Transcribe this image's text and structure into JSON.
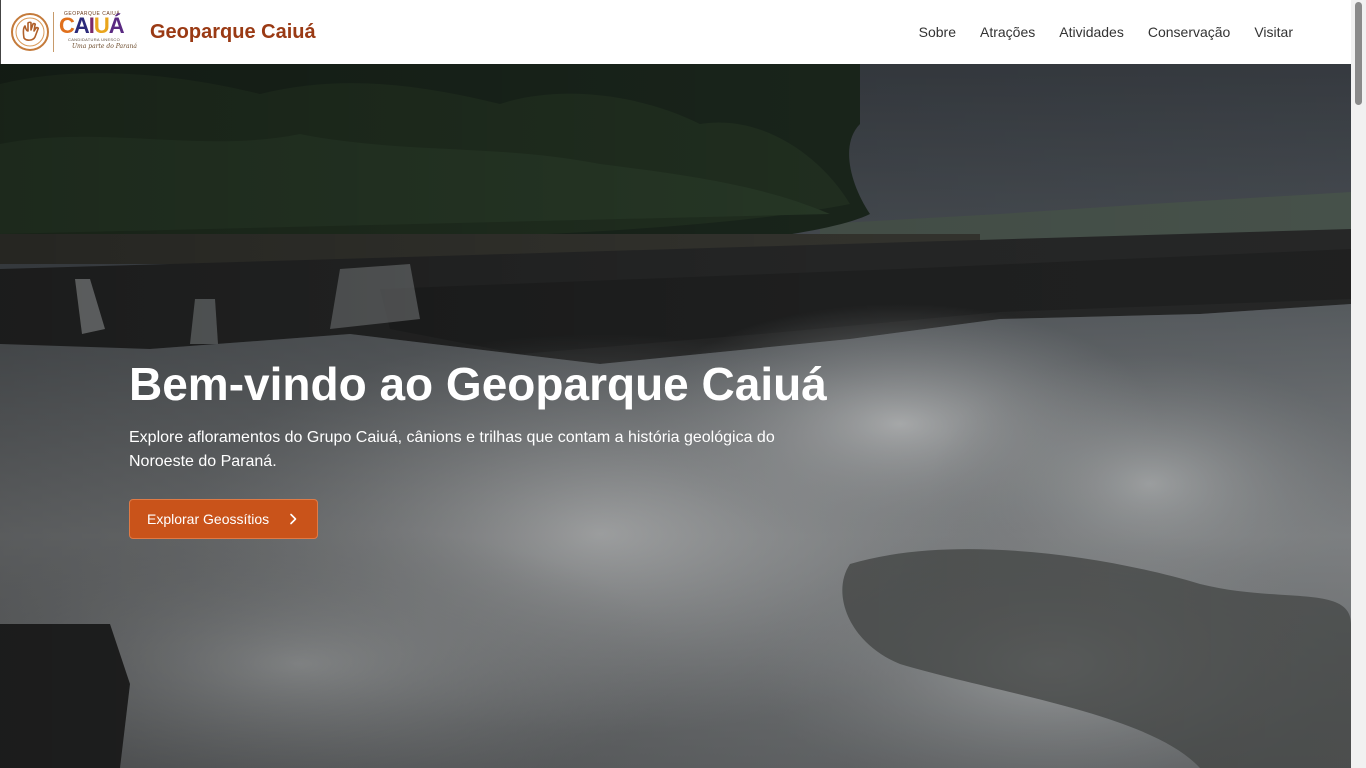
{
  "header": {
    "logo": {
      "tiny_top": "GEOPARQUE CAIUÁ",
      "wordmark_letters": [
        "C",
        "A",
        "I",
        "U",
        "Á"
      ],
      "tiny_mid": "CANDIDATURA UNESCO",
      "script": "Uma parte do Paraná"
    },
    "site_title": "Geoparque Caiuá",
    "nav": [
      "Sobre",
      "Atrações",
      "Atividades",
      "Conservação",
      "Visitar"
    ]
  },
  "hero": {
    "title": "Bem-vindo ao Geoparque Caiuá",
    "subtitle": "Explore afloramentos do Grupo Caiuá, cânions e trilhas que contam a história geológica do Noroeste do Paraná.",
    "cta_label": "Explorar Geossítios"
  },
  "colors": {
    "brand_title": "#9a3a14",
    "cta_background": "#c9531a",
    "nav_text": "#333333"
  },
  "icons": {
    "cta": "chevron-right-icon",
    "logo": "hand-emblem-icon"
  }
}
